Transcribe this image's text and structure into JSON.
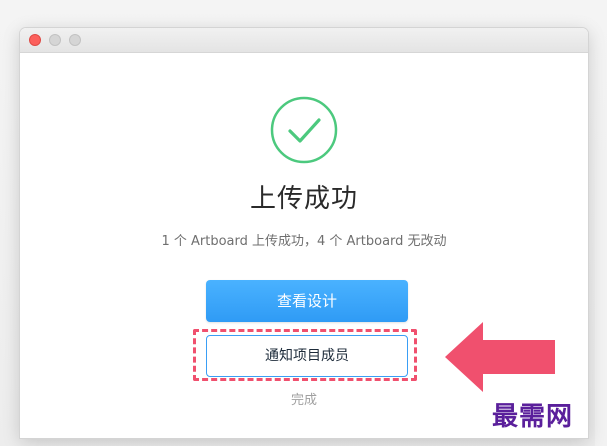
{
  "window": {
    "traffic_lights": [
      "close",
      "minimize",
      "maximize"
    ]
  },
  "dialog": {
    "success_icon": "check-circle-icon",
    "title": "上传成功",
    "subtitle": "1 个 Artboard 上传成功，4 个 Artboard 无改动",
    "primary_button": "查看设计",
    "secondary_button": "通知项目成员",
    "done_link": "完成"
  },
  "annotation": {
    "arrow_icon": "arrow-left-icon",
    "highlight_color": "#f0506e"
  },
  "watermark": {
    "text": "最需网"
  },
  "colors": {
    "success_green": "#4cc97e",
    "primary_blue": "#2f9bf5",
    "annotation_pink": "#f0506e",
    "watermark_purple": "#5a1f9b"
  }
}
